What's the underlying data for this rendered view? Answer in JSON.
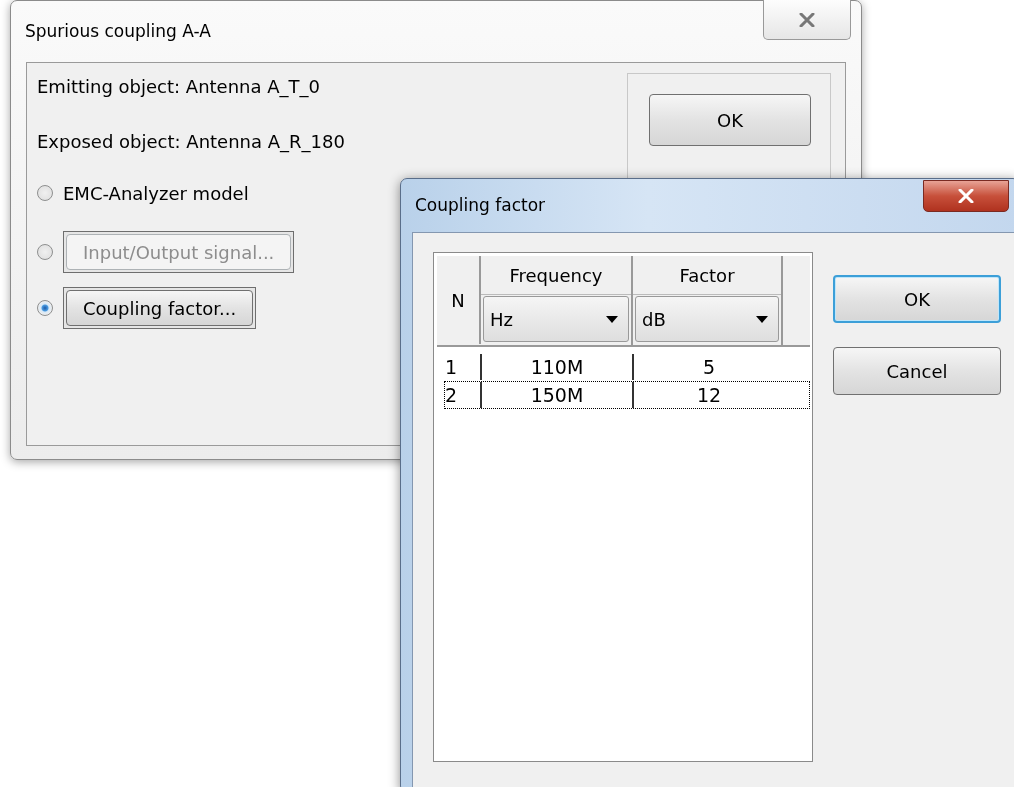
{
  "main_dialog": {
    "title": "Spurious coupling A-A",
    "emitting_object": "Emitting object: Antenna A_T_0",
    "exposed_object": "Exposed object: Antenna A_R_180",
    "options": [
      {
        "kind": "label",
        "label": "EMC-Analyzer model",
        "selected": false,
        "disabled": false
      },
      {
        "kind": "button",
        "label": "Input/Output signal...",
        "selected": false,
        "disabled": true
      },
      {
        "kind": "button",
        "label": "Coupling factor...",
        "selected": true,
        "disabled": false
      }
    ],
    "ok_button": "OK"
  },
  "coupling_dialog": {
    "title": "Coupling factor",
    "table": {
      "columns": [
        {
          "label": "N"
        },
        {
          "label": "Frequency",
          "unit": "Hz"
        },
        {
          "label": "Factor",
          "unit": "dB"
        }
      ],
      "rows": [
        {
          "cells": [
            "1",
            "110M",
            "5"
          ],
          "selected": false
        },
        {
          "cells": [
            "2",
            "150M",
            "12"
          ],
          "selected": true
        }
      ]
    },
    "buttons": [
      {
        "label": "OK",
        "focused": true
      },
      {
        "label": "Cancel",
        "focused": false
      }
    ]
  }
}
